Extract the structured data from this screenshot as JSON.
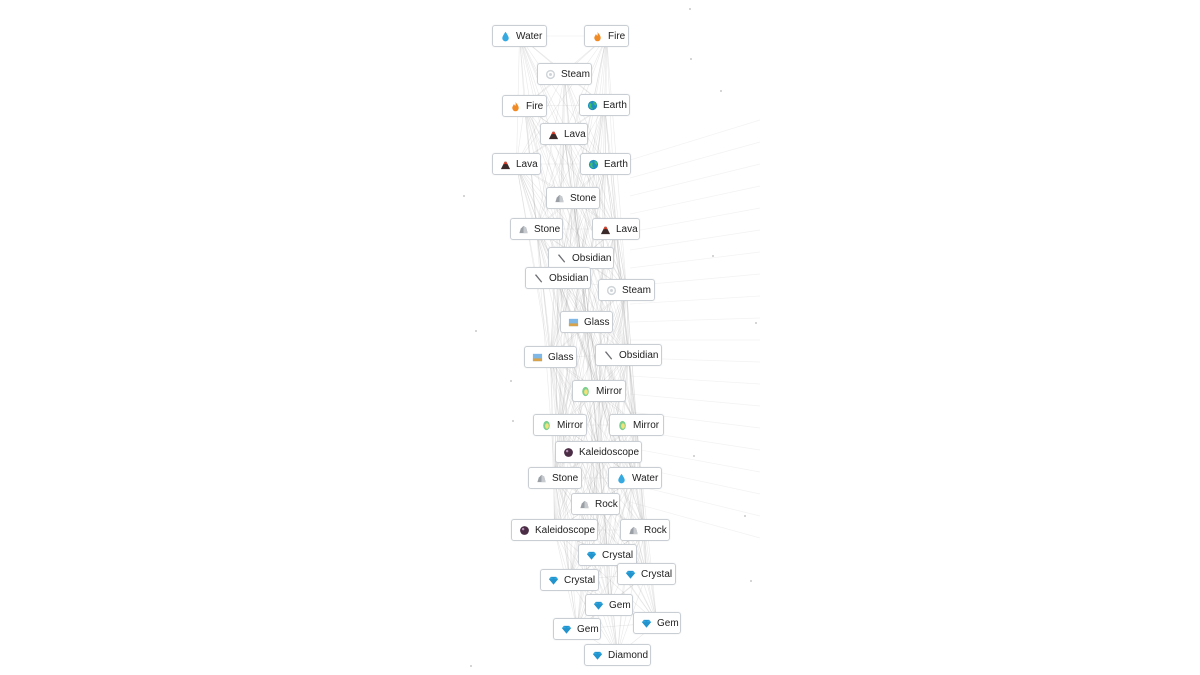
{
  "elements": {
    "Water": {
      "icon": "droplet-icon",
      "color": "#36a9e1"
    },
    "Fire": {
      "icon": "fire-icon",
      "color": "#f08a24"
    },
    "Steam": {
      "icon": "steam-icon",
      "color": "#cfd4d8"
    },
    "Earth": {
      "icon": "earth-icon",
      "color": "#1f9e8a"
    },
    "Lava": {
      "icon": "volcano-icon",
      "color": "#8b2e2a"
    },
    "Stone": {
      "icon": "rock-icon",
      "color": "#9aa0a6"
    },
    "Obsidian": {
      "icon": "obsidian-icon",
      "color": "#6d6f73"
    },
    "Glass": {
      "icon": "glass-icon",
      "color": "#4f9ad6"
    },
    "Mirror": {
      "icon": "mirror-icon",
      "color": "#7ccf8e"
    },
    "Kaleidoscope": {
      "icon": "kaleidoscope-icon",
      "color": "#4b2d46"
    },
    "Rock": {
      "icon": "rock-icon",
      "color": "#9aa0a6"
    },
    "Crystal": {
      "icon": "gem-icon",
      "color": "#2ea6de"
    },
    "Gem": {
      "icon": "gem-icon",
      "color": "#2ea6de"
    },
    "Diamond": {
      "icon": "gem-icon",
      "color": "#2ea6de"
    }
  },
  "nodes": [
    {
      "label": "Water"
    },
    {
      "label": "Fire"
    },
    {
      "label": "Steam"
    },
    {
      "label": "Fire"
    },
    {
      "label": "Earth"
    },
    {
      "label": "Lava"
    },
    {
      "label": "Lava"
    },
    {
      "label": "Earth"
    },
    {
      "label": "Stone"
    },
    {
      "label": "Stone"
    },
    {
      "label": "Lava"
    },
    {
      "label": "Obsidian"
    },
    {
      "label": "Obsidian"
    },
    {
      "label": "Steam"
    },
    {
      "label": "Glass"
    },
    {
      "label": "Glass"
    },
    {
      "label": "Obsidian"
    },
    {
      "label": "Mirror"
    },
    {
      "label": "Mirror"
    },
    {
      "label": "Mirror"
    },
    {
      "label": "Kaleidoscope"
    },
    {
      "label": "Stone"
    },
    {
      "label": "Water"
    },
    {
      "label": "Rock"
    },
    {
      "label": "Kaleidoscope"
    },
    {
      "label": "Rock"
    },
    {
      "label": "Crystal"
    },
    {
      "label": "Crystal"
    },
    {
      "label": "Crystal"
    },
    {
      "label": "Gem"
    },
    {
      "label": "Gem"
    },
    {
      "label": "Gem"
    },
    {
      "label": "Diamond"
    }
  ]
}
